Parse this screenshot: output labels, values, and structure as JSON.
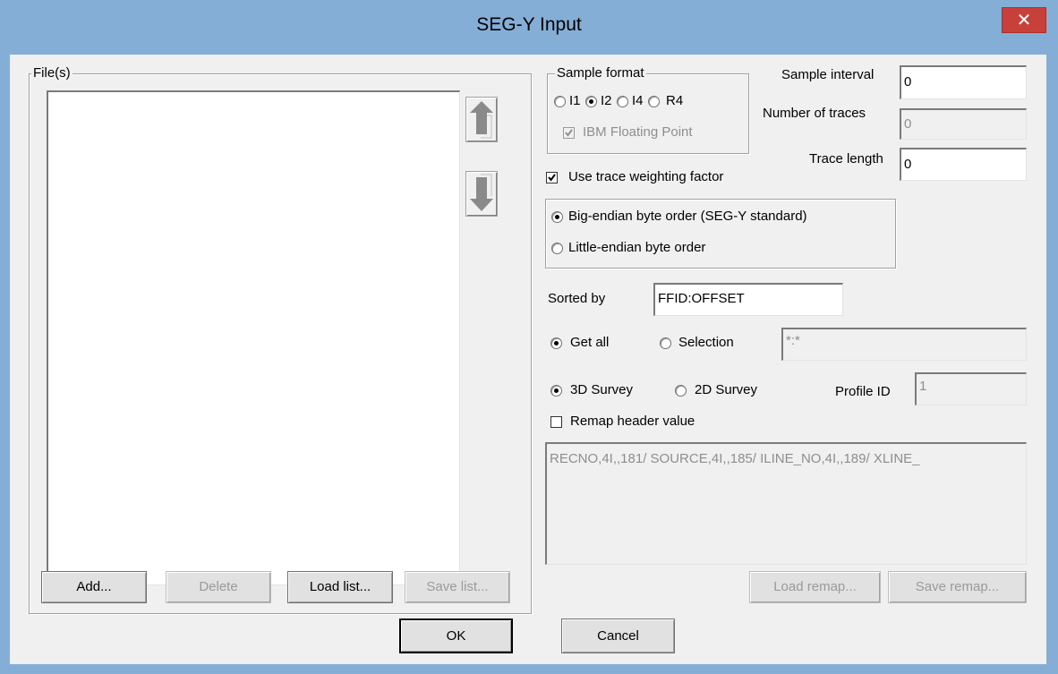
{
  "window": {
    "title": "SEG-Y Input",
    "close_label": "✕"
  },
  "files": {
    "group_label": "File(s)",
    "list": [],
    "move_up_icon": "arrow-up-icon",
    "move_down_icon": "arrow-down-icon",
    "add_label": "Add...",
    "delete_label": "Delete",
    "load_list_label": "Load list...",
    "save_list_label": "Save list..."
  },
  "sample_format": {
    "group_label": "Sample format",
    "options": [
      "I1",
      "I2",
      "I4",
      "R4"
    ],
    "selected": "I2",
    "ibm_label": "IBM Floating Point",
    "ibm_checked": true
  },
  "fields": {
    "sample_interval_label": "Sample interval",
    "sample_interval_value": "0",
    "num_traces_label": "Number of traces",
    "num_traces_value": "0",
    "trace_length_label": "Trace length",
    "trace_length_value": "0"
  },
  "use_trace_weighting_label": "Use trace weighting factor",
  "use_trace_weighting_checked": true,
  "byte_order": {
    "big_endian_label": "Big-endian byte order (SEG-Y standard)",
    "little_endian_label": "Little-endian byte order",
    "selected": "big"
  },
  "sorted_by": {
    "label": "Sorted by",
    "value": "FFID:OFFSET"
  },
  "selection": {
    "get_all_label": "Get all",
    "selection_label": "Selection",
    "selection_value": "*:*",
    "selected": "get_all"
  },
  "survey": {
    "survey_3d_label": "3D Survey",
    "survey_2d_label": "2D Survey",
    "selected": "3D",
    "profile_id_label": "Profile ID",
    "profile_id_value": "1"
  },
  "remap": {
    "checkbox_label": "Remap header value",
    "checked": false,
    "text": "RECNO,4I,,181/ SOURCE,4I,,185/ ILINE_NO,4I,,189/ XLINE_",
    "load_label": "Load remap...",
    "save_label": "Save remap..."
  },
  "buttons": {
    "ok_label": "OK",
    "cancel_label": "Cancel"
  },
  "colors": {
    "title_bar": "#85aed6",
    "close_button": "#c7413a",
    "dialog_bg": "#f0f0f0"
  }
}
